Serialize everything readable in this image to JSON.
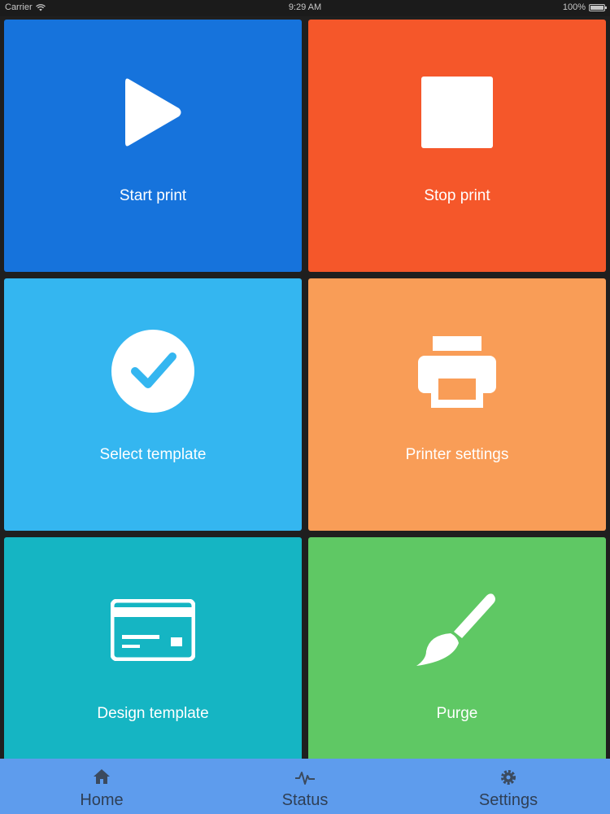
{
  "status_bar": {
    "carrier": "Carrier",
    "time": "9:29 AM",
    "battery": "100%"
  },
  "tiles": [
    {
      "label": "Start print",
      "icon": "play-icon",
      "color": "#1673dc"
    },
    {
      "label": "Stop print",
      "icon": "stop-icon",
      "color": "#f5572a"
    },
    {
      "label": "Select template",
      "icon": "check-circle-icon",
      "color": "#34b6f0"
    },
    {
      "label": "Printer settings",
      "icon": "printer-icon",
      "color": "#f99d57"
    },
    {
      "label": "Design template",
      "icon": "card-icon",
      "color": "#15b5c3"
    },
    {
      "label": "Purge",
      "icon": "brush-icon",
      "color": "#5fc864"
    }
  ],
  "tab_bar": {
    "color": "#5e9ced",
    "items": [
      {
        "label": "Home",
        "icon": "home-icon"
      },
      {
        "label": "Status",
        "icon": "pulse-icon"
      },
      {
        "label": "Settings",
        "icon": "gear-icon"
      }
    ]
  }
}
